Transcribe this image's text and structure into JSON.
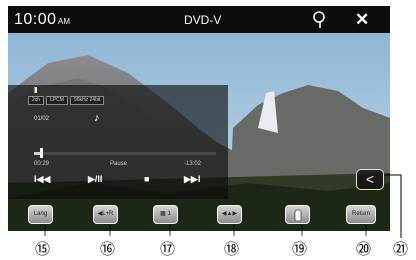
{
  "status_bar": {
    "time": "10:00",
    "ampm": "AM",
    "source": "DVD-V",
    "search_icon": "search-icon",
    "close_icon": "close-icon",
    "close_glyph": "✕"
  },
  "osd": {
    "pause_mark": "II",
    "badges": [
      "2ch",
      "LPCM",
      "96kHz 24bit"
    ],
    "chapter": "01/02",
    "note": "♪",
    "progress_fraction": 0.04,
    "elapsed": "00:29",
    "status": "Pause",
    "remaining": "-13:02",
    "controls": [
      "I◀◀",
      "▶/II",
      "■",
      "▶▶I"
    ]
  },
  "touch_keys": [
    {
      "name": "language-key",
      "label": "Lang"
    },
    {
      "name": "audio-key",
      "label": "◀L+R"
    },
    {
      "name": "subtitle-key",
      "label": "▩ 1"
    },
    {
      "name": "direction-key",
      "label": "◀▲▶"
    },
    {
      "name": "bookmark-key",
      "label": ""
    },
    {
      "name": "return-key",
      "label": "Return"
    }
  ],
  "back_key": {
    "glyph": "<"
  },
  "callouts": [
    "⑮",
    "⑯",
    "⑰",
    "⑱",
    "⑲",
    "⑳",
    "㉑"
  ],
  "colors": {
    "status_bar": "#0c0c0c",
    "button_face": "#b0b0b0"
  }
}
